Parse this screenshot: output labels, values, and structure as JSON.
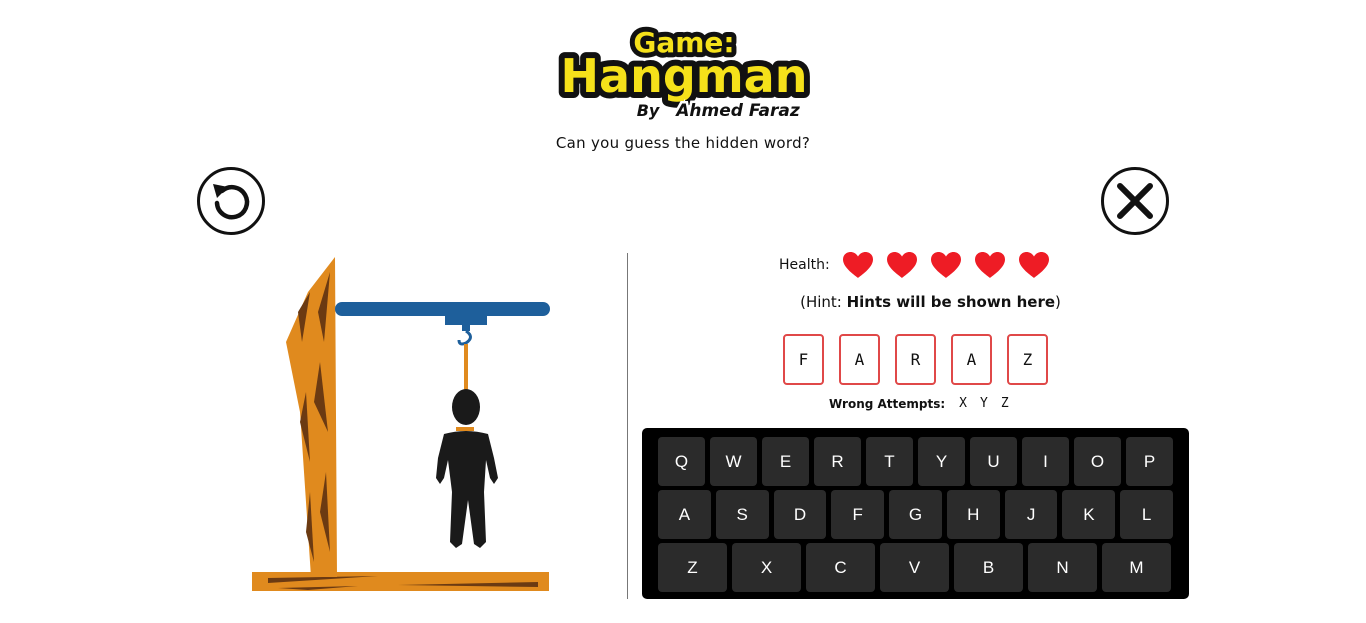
{
  "header": {
    "logo_line1": "Game:",
    "logo_line2": "Hangman",
    "logo_by": "By",
    "logo_author": "Ahmed Faraz",
    "subtitle": "Can you guess the hidden word?"
  },
  "controls": {
    "restart_icon": "restart-icon",
    "close_icon": "close-icon"
  },
  "health": {
    "label": "Health:",
    "hearts": 5,
    "heart_color": "#ee1c25"
  },
  "hint": {
    "prefix": "(Hint: ",
    "text": "Hints will be shown here",
    "suffix": ")"
  },
  "word_slots": [
    "F",
    "A",
    "R",
    "A",
    "Z"
  ],
  "wrong_attempts": {
    "label": "Wrong Attempts:",
    "letters": [
      "X",
      "Y",
      "Z"
    ]
  },
  "keyboard": {
    "rows": [
      [
        "Q",
        "W",
        "E",
        "R",
        "T",
        "Y",
        "U",
        "I",
        "O",
        "P"
      ],
      [
        "A",
        "S",
        "D",
        "F",
        "G",
        "H",
        "J",
        "K",
        "L"
      ],
      [
        "Z",
        "X",
        "C",
        "V",
        "B",
        "N",
        "M"
      ]
    ]
  },
  "colors": {
    "wood": "#e08a1e",
    "beam": "#1e5f9b",
    "figure": "#1a1a1a",
    "slot_border": "#e04848",
    "logo_yellow": "#f5e11a"
  }
}
